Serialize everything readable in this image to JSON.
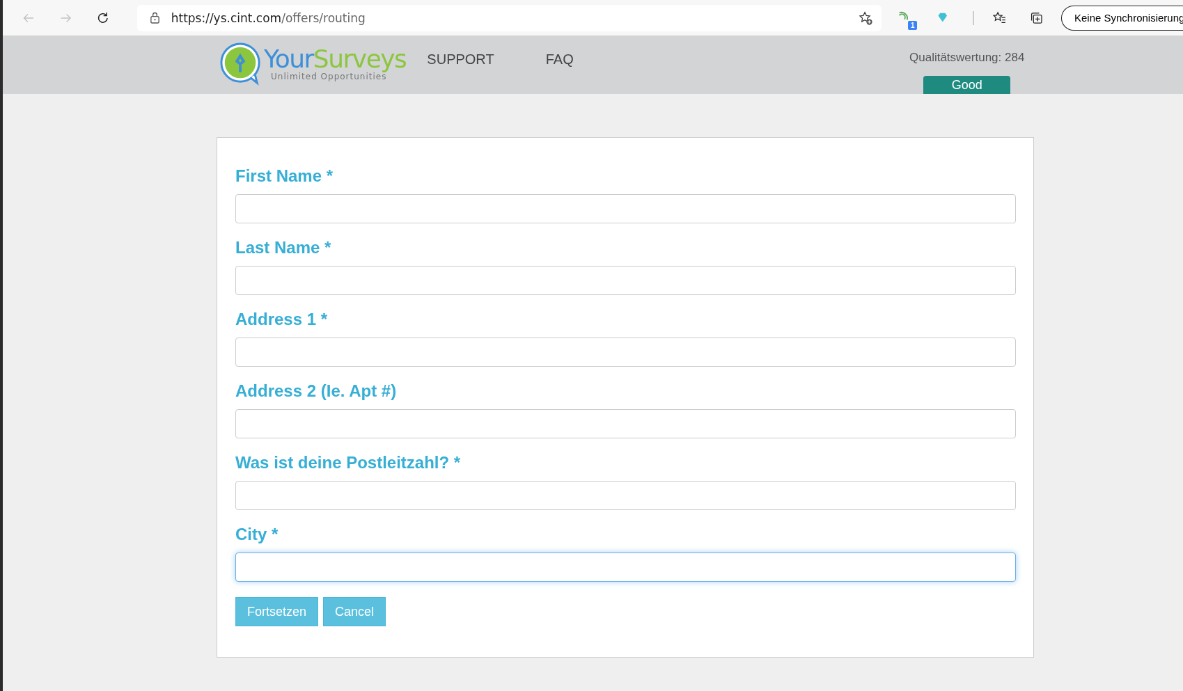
{
  "browser": {
    "url_host": "https://ys.cint.com",
    "url_path": "/offers/routing",
    "extension_badge": "1",
    "sync_button": "Keine Synchronisierung"
  },
  "header": {
    "logo": {
      "word_1": "Your",
      "word_2": "Surveys",
      "tagline": "Unlimited Opportunities"
    },
    "nav": [
      "SUPPORT",
      "FAQ"
    ],
    "quality_score": "Qualitätswertung: 284",
    "quality_badge": "Good"
  },
  "form": {
    "fields": [
      {
        "label": "First Name *",
        "focused": false
      },
      {
        "label": "Last Name *",
        "focused": false
      },
      {
        "label": "Address 1 *",
        "focused": false
      },
      {
        "label": "Address 2 (Ie. Apt #)",
        "focused": false
      },
      {
        "label": "Was ist deine Postleitzahl? *",
        "focused": false
      },
      {
        "label": "City *",
        "focused": true
      }
    ],
    "buttons": [
      "Fortsetzen",
      "Cancel"
    ]
  }
}
